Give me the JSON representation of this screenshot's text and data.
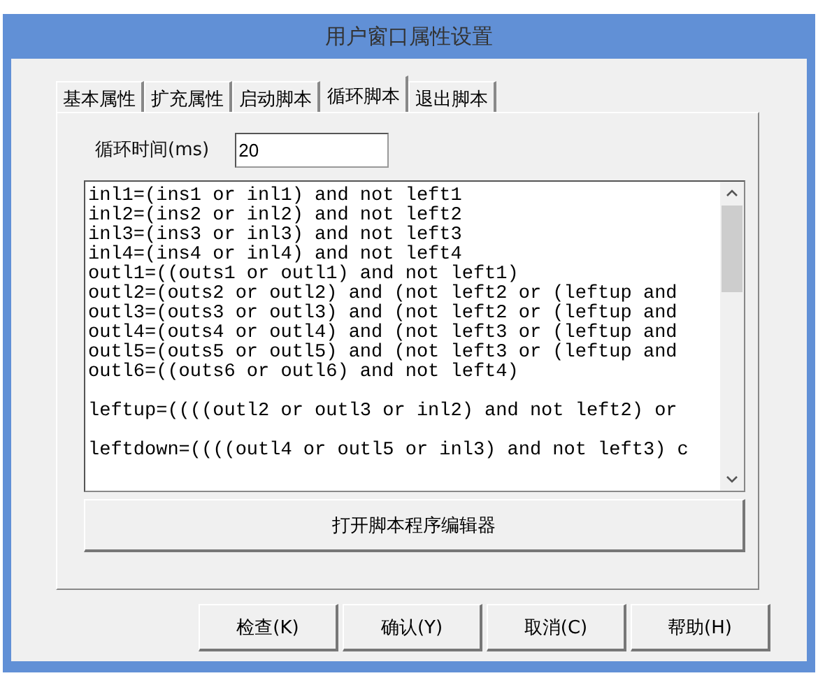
{
  "window": {
    "title": "用户窗口属性设置"
  },
  "tabs": [
    {
      "label": "基本属性",
      "selected": false
    },
    {
      "label": "扩充属性",
      "selected": false
    },
    {
      "label": "启动脚本",
      "selected": false
    },
    {
      "label": "循环脚本",
      "selected": true
    },
    {
      "label": "退出脚本",
      "selected": false
    }
  ],
  "loop_time": {
    "label": "循环时间(ms)",
    "value": "20"
  },
  "script": {
    "blocks": [
      [
        "inl1=(ins1 or inl1) and not left1",
        "inl2=(ins2 or inl2) and not left2",
        "inl3=(ins3 or inl3) and not left3",
        "inl4=(ins4 or inl4) and not left4",
        "outl1=((outs1 or outl1) and not left1)",
        "outl2=(outs2 or outl2) and (not left2 or (leftup and",
        "outl3=(outs3 or outl3) and (not left2 or (leftup and",
        "outl4=(outs4 or outl4) and (not left3 or (leftup and",
        "outl5=(outs5 or outl5) and (not left3 or (leftup and",
        "outl6=((outs6 or outl6) and not left4)"
      ],
      [
        "leftup=((((outl2 or outl3 or inl2) and not left2) or"
      ],
      [
        "leftdown=((((outl4 or outl5 or inl3) and not left3) c"
      ]
    ]
  },
  "editor_button": "打开脚本程序编辑器",
  "buttons": [
    "检查(K)",
    "确认(Y)",
    "取消(C)",
    "帮助(H)"
  ]
}
